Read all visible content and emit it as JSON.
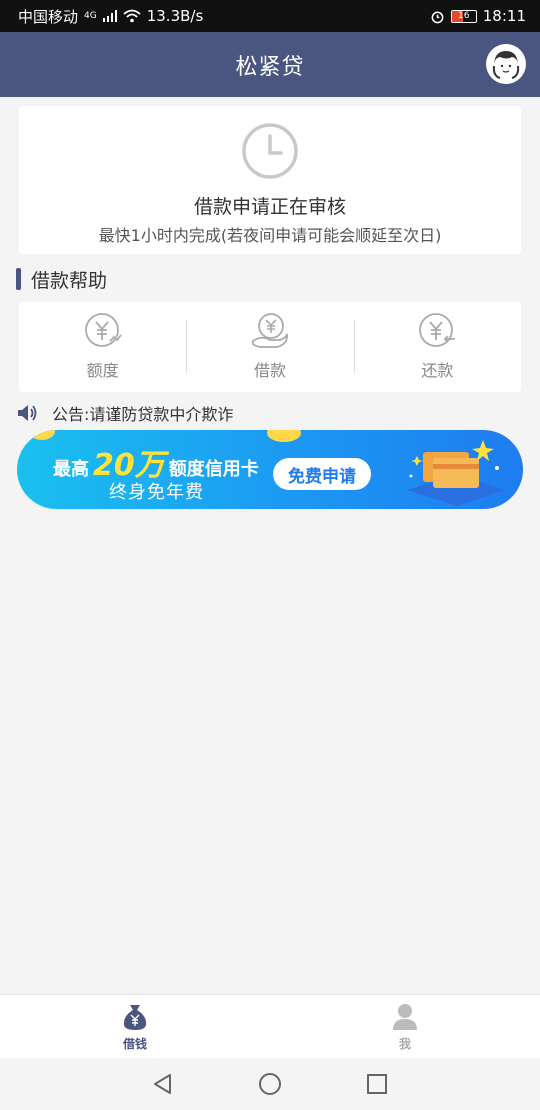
{
  "status_bar": {
    "carrier": "中国移动",
    "network": "4G",
    "speed": "13.3B/s",
    "battery": "16",
    "time": "18:11"
  },
  "header": {
    "title": "松紧贷",
    "service_icon": "customer-service-avatar-icon"
  },
  "review": {
    "icon": "clock-icon",
    "title": "借款申请正在审核",
    "subtitle": "最快1小时内完成(若夜间申请可能会顺延至次日)"
  },
  "help": {
    "heading": "借款帮助",
    "items": [
      {
        "label": "额度",
        "icon": "yen-quota-icon"
      },
      {
        "label": "借款",
        "icon": "yen-hand-icon"
      },
      {
        "label": "还款",
        "icon": "yen-return-icon"
      }
    ]
  },
  "notice": {
    "icon": "speaker-icon",
    "text": "公告:请谨防贷款中介欺诈"
  },
  "banner": {
    "prefix": "最高",
    "amount": "20万",
    "suffix": "额度信用卡",
    "line2": "终身免年费",
    "button": "免费申请"
  },
  "tabbar": {
    "tabs": [
      {
        "label": "借钱",
        "icon": "money-bag-icon",
        "active": true
      },
      {
        "label": "我",
        "icon": "person-icon",
        "active": false
      }
    ]
  },
  "colors": {
    "primary": "#4a5580",
    "banner_start": "#1ac0f0",
    "banner_end": "#1e7cf0",
    "highlight": "#ffe23a"
  }
}
